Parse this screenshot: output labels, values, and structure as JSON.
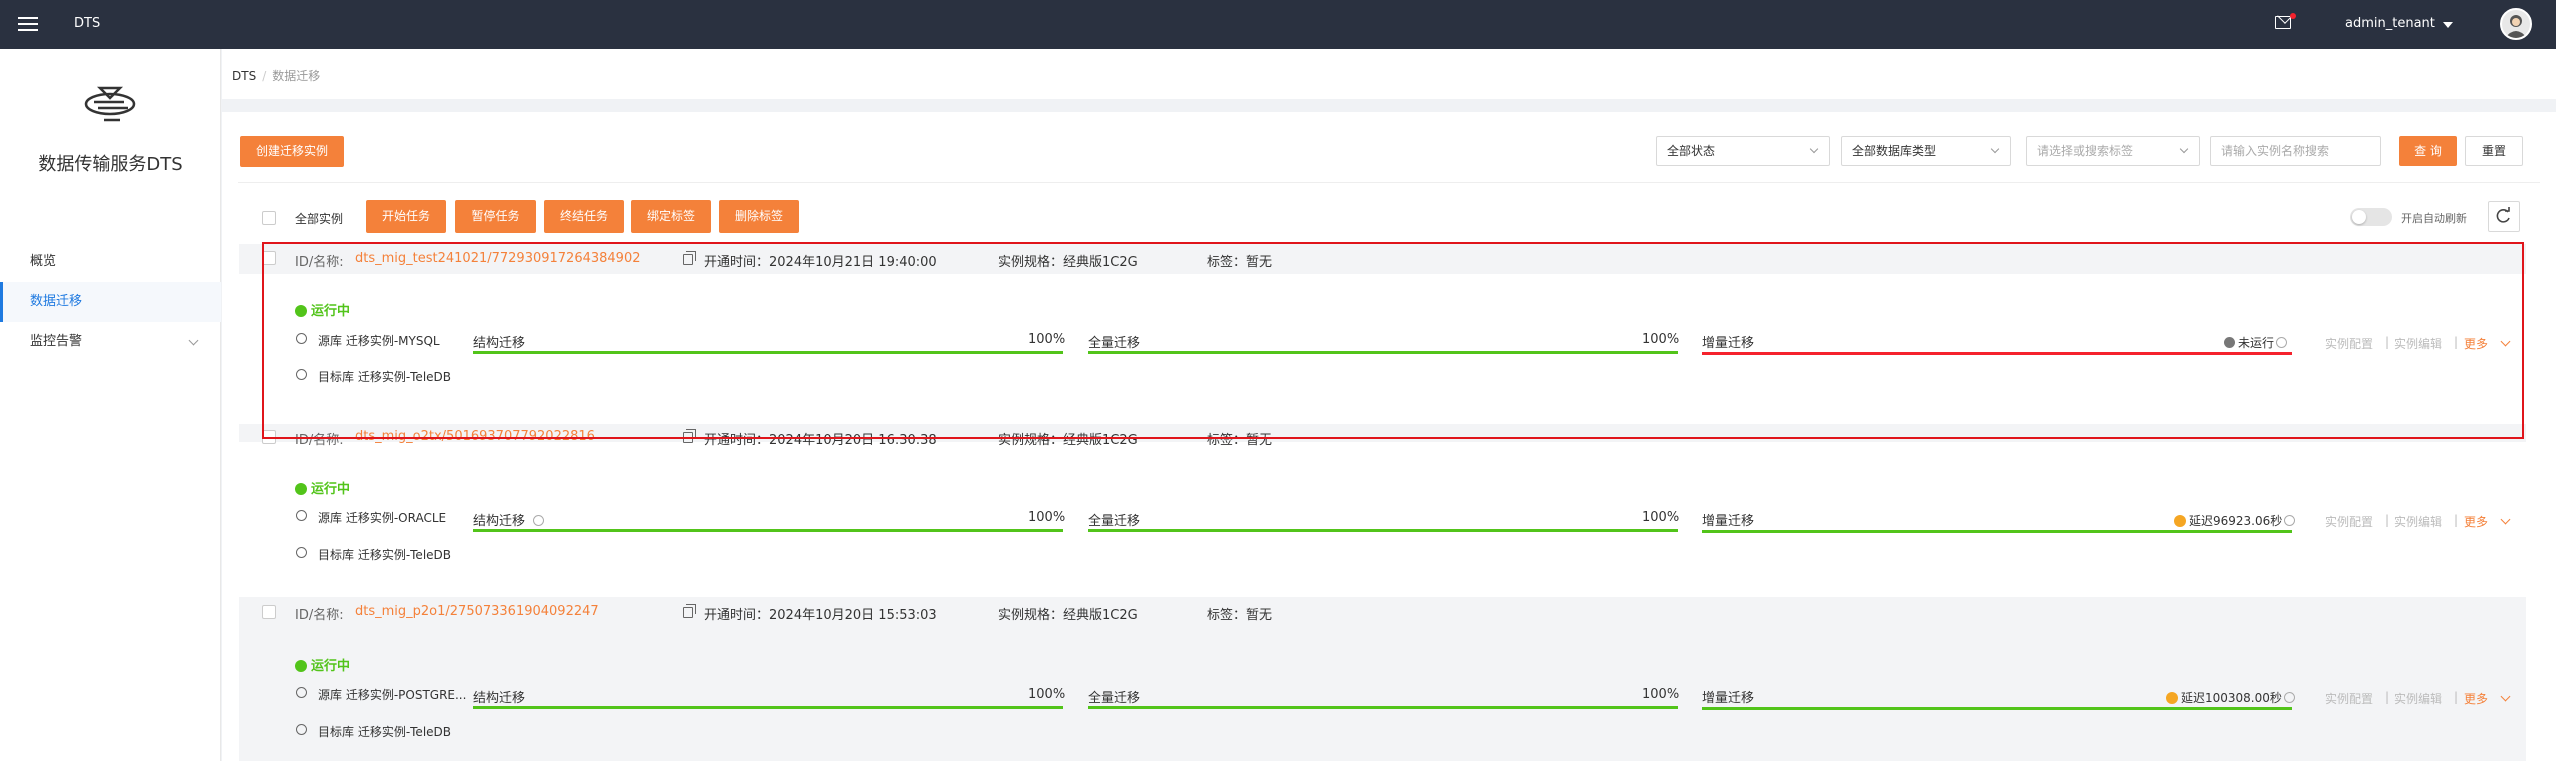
{
  "header": {
    "app_title": "DTS",
    "user": "admin_tenant"
  },
  "sidebar": {
    "product_name": "数据传输服务DTS",
    "items": [
      {
        "label": "概览"
      },
      {
        "label": "数据迁移"
      },
      {
        "label": "监控告警"
      }
    ]
  },
  "breadcrumb": {
    "root": "DTS",
    "current": "数据迁移"
  },
  "toolbar": {
    "create_label": "创建迁移实例",
    "status_select": "全部状态",
    "dbtype_select": "全部数据库类型",
    "tag_placeholder": "请选择或搜索标签",
    "search_placeholder": "请输入实例名称搜索",
    "query_label": "查 询",
    "reset_label": "重置"
  },
  "batch": {
    "select_all": "全部实例",
    "start": "开始任务",
    "pause": "暂停任务",
    "stop": "终结任务",
    "bind_tag": "绑定标签",
    "delete_tag": "删除标签",
    "auto_refresh": "开启自动刷新"
  },
  "instances": [
    {
      "id_label": "ID/名称:",
      "id": "dts_mig_test241021/772930917264384902",
      "open_time": "开通时间：2024年10月21日 19:40:00",
      "spec": "实例规格：经典版1C2G",
      "tags": "标签：暂无",
      "status": "运行中",
      "source": "源库 迁移实例-MYSQL",
      "target": "目标库 迁移实例-TeleDB",
      "struct_label": "结构迁移",
      "struct_pct": "100%",
      "full_label": "全量迁移",
      "full_pct": "100%",
      "inc_label": "增量迁移",
      "inc_status": "未运行",
      "action_config": "实例配置",
      "action_edit": "实例编辑",
      "action_more": "更多"
    },
    {
      "id_label": "ID/名称:",
      "id": "dts_mig_o2tx/501693707792022816",
      "open_time": "开通时间：2024年10月20日 16:30:38",
      "spec": "实例规格：经典版1C2G",
      "tags": "标签：暂无",
      "status": "运行中",
      "source": "源库 迁移实例-ORACLE",
      "target": "目标库 迁移实例-TeleDB",
      "struct_label": "结构迁移",
      "struct_pct": "100%",
      "full_label": "全量迁移",
      "full_pct": "100%",
      "inc_label": "增量迁移",
      "inc_status": "延迟96923.06秒",
      "action_config": "实例配置",
      "action_edit": "实例编辑",
      "action_more": "更多"
    },
    {
      "id_label": "ID/名称:",
      "id": "dts_mig_p2o1/275073361904092247",
      "open_time": "开通时间：2024年10月20日 15:53:03",
      "spec": "实例规格：经典版1C2G",
      "tags": "标签：暂无",
      "status": "运行中",
      "source": "源库 迁移实例-POSTGRE...",
      "target": "目标库 迁移实例-TeleDB",
      "struct_label": "结构迁移",
      "struct_pct": "100%",
      "full_label": "全量迁移",
      "full_pct": "100%",
      "inc_label": "增量迁移",
      "inc_status": "延迟100308.00秒",
      "action_config": "实例配置",
      "action_edit": "实例编辑",
      "action_more": "更多"
    }
  ],
  "colors": {
    "accent": "#f4813a",
    "topbar": "#2a3140",
    "success": "#52c41a",
    "highlight": "#e0151b",
    "link_blue": "#1f7ae0"
  }
}
